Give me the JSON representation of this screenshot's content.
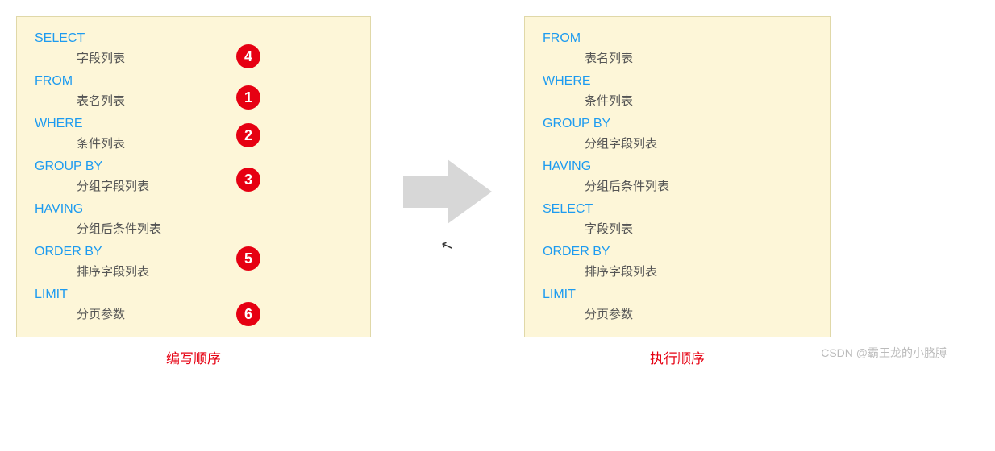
{
  "left": {
    "caption": "编写顺序",
    "items": [
      {
        "kw": "SELECT",
        "desc": "字段列表",
        "badge": "4",
        "badgeTop": 16
      },
      {
        "kw": "FROM",
        "desc": "表名列表",
        "badge": "1",
        "badgeTop": 14
      },
      {
        "kw": "WHERE",
        "desc": "条件列表",
        "badge": "2",
        "badgeTop": 8
      },
      {
        "kw": "GROUP  BY",
        "desc": "分组字段列表",
        "badge": "3",
        "badgeTop": 10
      },
      {
        "kw": "HAVING",
        "desc": "分组后条件列表",
        "badge": null
      },
      {
        "kw": "ORDER BY",
        "desc": "排序字段列表",
        "badge": "5",
        "badgeTop": 2
      },
      {
        "kw": "LIMIT",
        "desc": "分页参数",
        "badge": "6",
        "badgeTop": 18
      }
    ]
  },
  "right": {
    "caption": "执行顺序",
    "items": [
      {
        "kw": "FROM",
        "desc": "表名列表"
      },
      {
        "kw": "WHERE",
        "desc": "条件列表"
      },
      {
        "kw": "GROUP  BY",
        "desc": "分组字段列表"
      },
      {
        "kw": "HAVING",
        "desc": "分组后条件列表"
      },
      {
        "kw": " SELECT",
        "desc": "字段列表"
      },
      {
        "kw": "ORDER BY",
        "desc": "排序字段列表"
      },
      {
        "kw": "LIMIT",
        "desc": "分页参数"
      }
    ]
  },
  "watermark": "CSDN @霸王龙的小胳膊",
  "cursor_glyph": "↖"
}
